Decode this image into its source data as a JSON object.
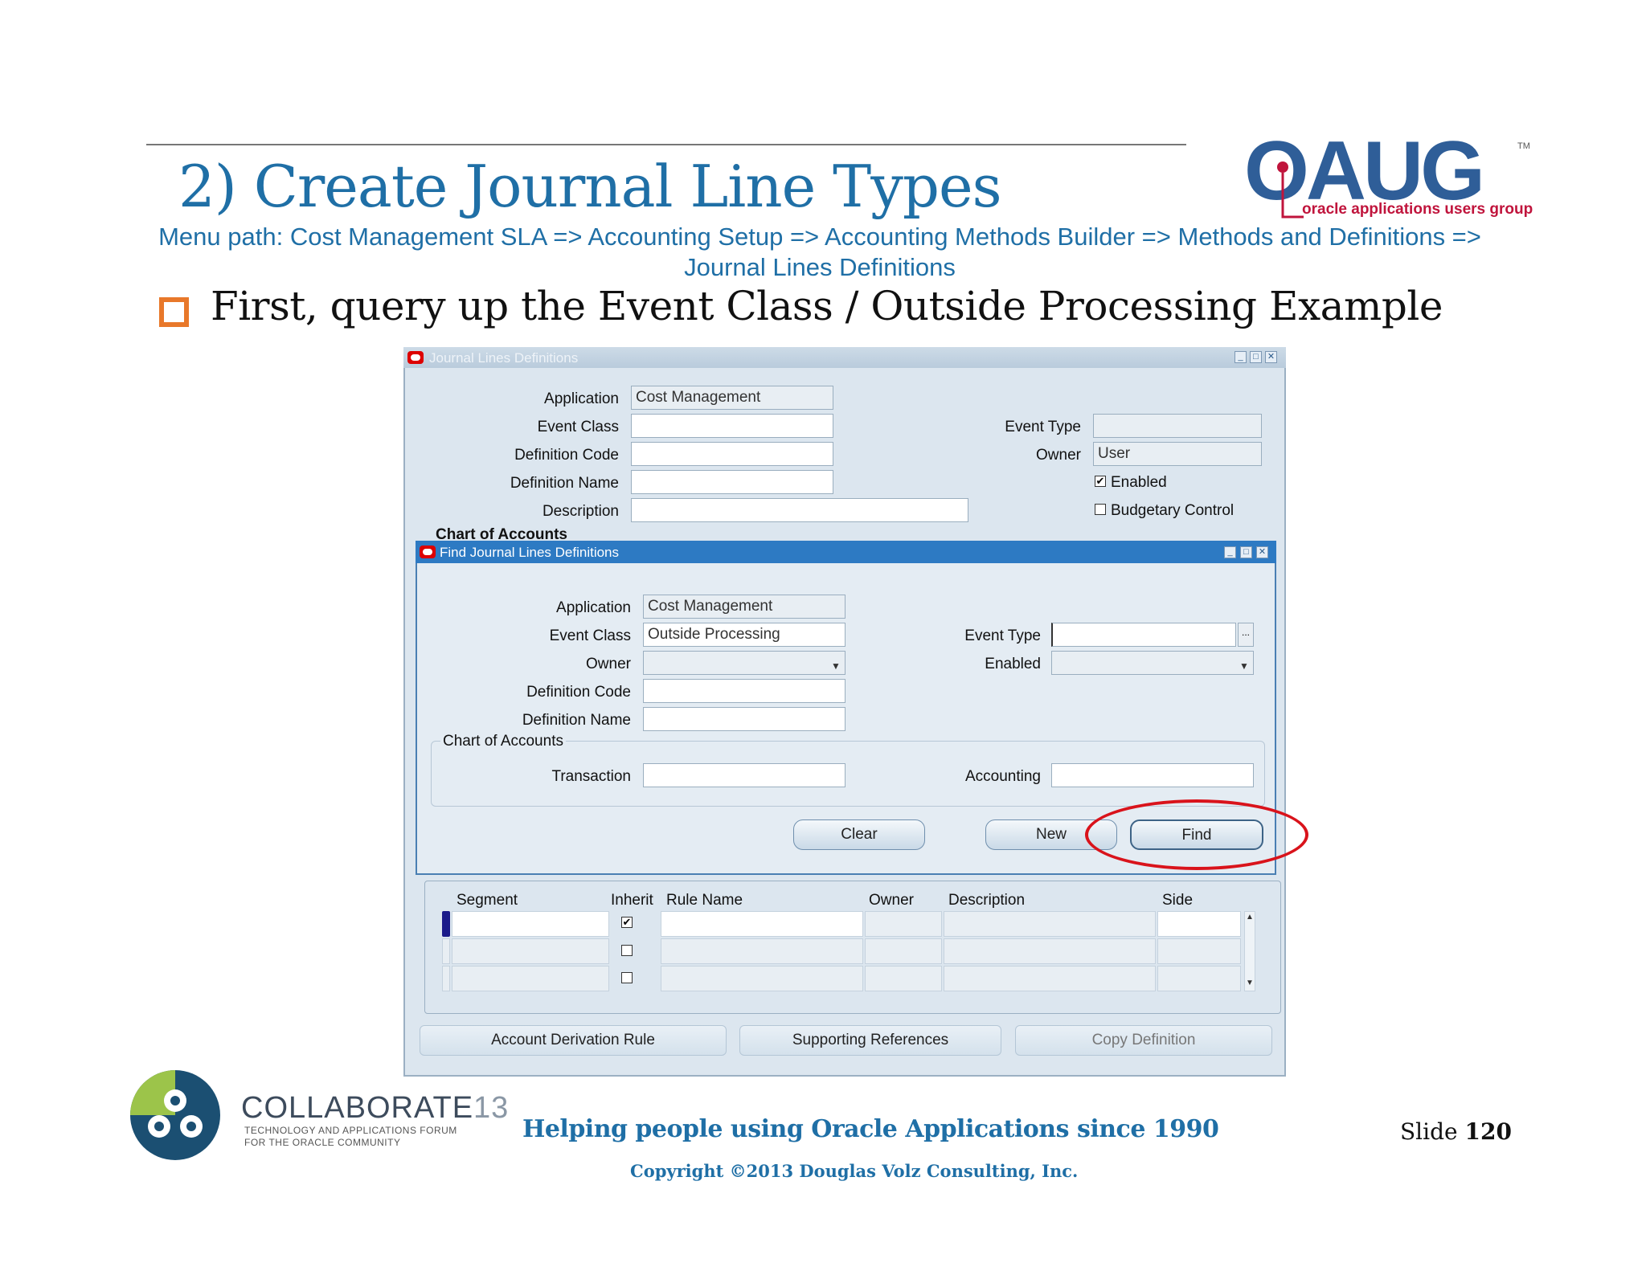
{
  "slide": {
    "title": "2) Create Journal Line Types",
    "menu_path_line1": "Menu path: Cost Management SLA => Accounting Setup => Accounting Methods Builder => Methods and Definitions =>",
    "menu_path_line2": "Journal Lines Definitions",
    "bullet": "First, query up the Event Class / Outside Processing Example",
    "logo_text": "OAUG",
    "logo_tm": "TM",
    "logo_subtitle": "oracle applications users group",
    "footer_tagline": "Helping people using Oracle Applications since 1990",
    "copyright": "Copyright ©2013 Douglas Volz Consulting, Inc.",
    "slide_label": "Slide",
    "slide_number": "120",
    "collab_name": "COLLABORATE",
    "collab_year": "13",
    "collab_sub1": "TECHNOLOGY AND APPLICATIONS FORUM",
    "collab_sub2": "FOR THE ORACLE COMMUNITY"
  },
  "main_window": {
    "title": "Journal Lines Definitions",
    "application_label": "Application",
    "application_value": "Cost Management",
    "event_class_label": "Event Class",
    "definition_code_label": "Definition Code",
    "definition_name_label": "Definition Name",
    "description_label": "Description",
    "event_type_label": "Event Type",
    "owner_label": "Owner",
    "owner_value": "User",
    "enabled_label": "Enabled",
    "enabled_checked": "✔",
    "budgetary_label": "Budgetary Control",
    "chart_of_accounts_label": "Chart of Accounts",
    "grid_headers": {
      "segment": "Segment",
      "inherit": "Inherit",
      "rule_name": "Rule Name",
      "owner": "Owner",
      "description": "Description",
      "side": "Side"
    },
    "inherit_row1": "✔",
    "buttons": {
      "account_derivation": "Account Derivation Rule",
      "supporting_references": "Supporting References",
      "copy_definition": "Copy Definition"
    }
  },
  "find_dialog": {
    "title": "Find Journal Lines Definitions",
    "application_label": "Application",
    "application_value": "Cost Management",
    "event_class_label": "Event Class",
    "event_class_value": "Outside Processing",
    "owner_label": "Owner",
    "definition_code_label": "Definition Code",
    "definition_name_label": "Definition Name",
    "event_type_label": "Event Type",
    "enabled_label": "Enabled",
    "chart_of_accounts_label": "Chart of Accounts",
    "transaction_label": "Transaction",
    "accounting_label": "Accounting",
    "lov_glyph": "...",
    "buttons": {
      "clear": "Clear",
      "new": "New",
      "find": "Find"
    }
  },
  "colors": {
    "accent_blue": "#1f6fa6",
    "dialog_title_blue": "#2d7ac3",
    "highlight_red": "#d9131b",
    "bullet_orange": "#e8782a"
  }
}
